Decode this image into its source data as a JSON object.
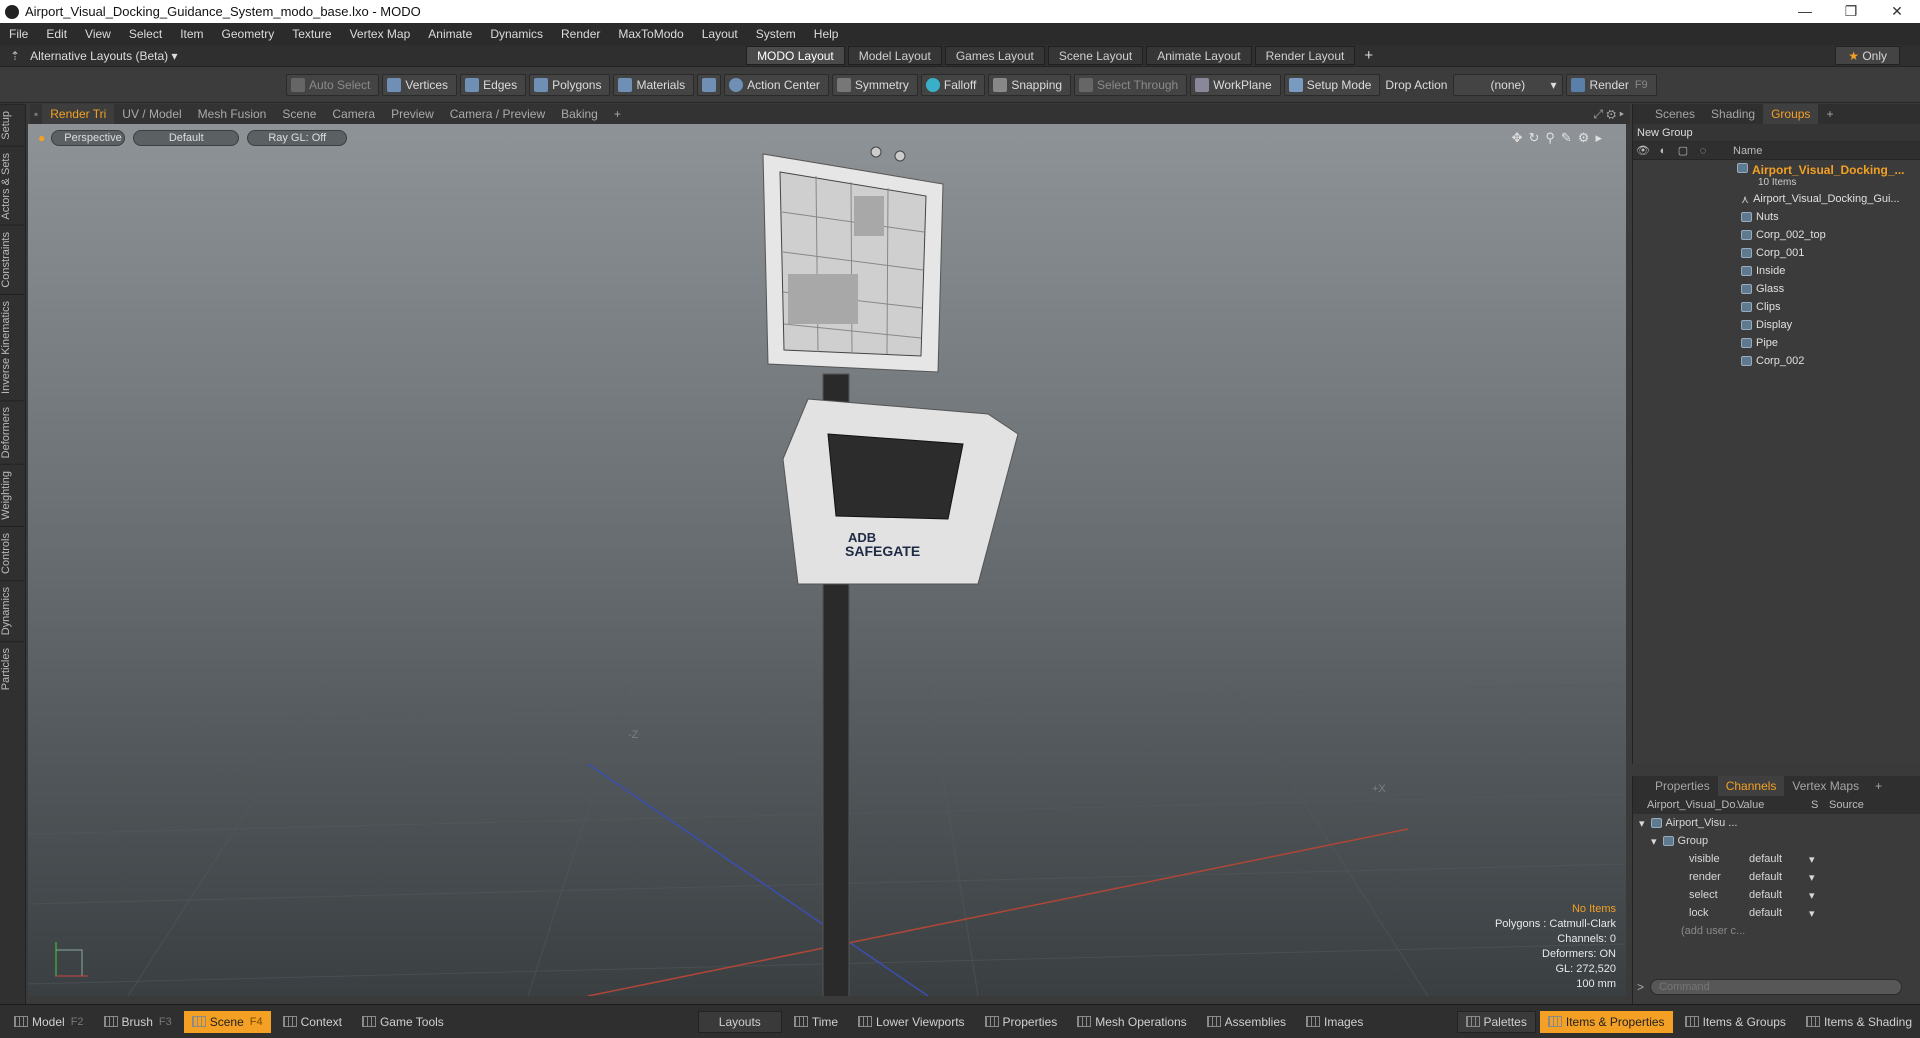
{
  "window": {
    "title": "Airport_Visual_Docking_Guidance_System_modo_base.lxo - MODO"
  },
  "menu": [
    "File",
    "Edit",
    "View",
    "Select",
    "Item",
    "Geometry",
    "Texture",
    "Vertex Map",
    "Animate",
    "Dynamics",
    "Render",
    "MaxToModo",
    "Layout",
    "System",
    "Help"
  ],
  "layouts": {
    "selector": "Alternative Layouts (Beta)",
    "tabs": [
      "MODO Layout",
      "Model Layout",
      "Games Layout",
      "Scene Layout",
      "Animate Layout",
      "Render Layout"
    ],
    "only": "Only"
  },
  "toolbar": {
    "auto_select": "Auto Select",
    "vertices": "Vertices",
    "edges": "Edges",
    "polygons": "Polygons",
    "materials": "Materials",
    "action_center": "Action Center",
    "symmetry": "Symmetry",
    "falloff": "Falloff",
    "snapping": "Snapping",
    "select_through": "Select Through",
    "workplane": "WorkPlane",
    "setup_mode": "Setup Mode",
    "drop_action": "Drop Action",
    "drop_value": "(none)",
    "render": "Render",
    "render_key": "F9"
  },
  "viewport_tabs": [
    "Render Tri",
    "UV / Model",
    "Mesh Fusion",
    "Scene",
    "Camera",
    "Preview",
    "Camera / Preview",
    "Baking"
  ],
  "left_strip": [
    "Setup",
    "Actors & Sets",
    "Constraints",
    "Inverse Kinematics",
    "Deformers",
    "Weighting",
    "Controls",
    "Dynamics",
    "Particles"
  ],
  "viewport": {
    "view": "Perspective",
    "shading": "Default",
    "raygl": "Ray GL: Off",
    "axis_z": "-Z",
    "axis_x": "+X",
    "info": {
      "selection": "No Items",
      "polygons": "Polygons : Catmull-Clark",
      "channels": "Channels: 0",
      "deformers": "Deformers: ON",
      "gl": "GL: 272,520",
      "scale": "100 mm"
    },
    "model_label_1": "ADB",
    "model_label_2": "SAFEGATE"
  },
  "groups_panel": {
    "tabs": [
      "Scenes",
      "Shading",
      "Groups"
    ],
    "new_group": "New Group",
    "name_col": "Name",
    "root": "Airport_Visual_Docking_...",
    "root_count": "10 Items",
    "items": [
      "Airport_Visual_Docking_Gui...",
      "Nuts",
      "Corp_002_top",
      "Corp_001",
      "Inside",
      "Glass",
      "Clips",
      "Display",
      "Pipe",
      "Corp_002"
    ]
  },
  "channels_panel": {
    "tabs": [
      "Properties",
      "Channels",
      "Vertex Maps"
    ],
    "col_item": "Airport_Visual_Do...",
    "col_value": "Value",
    "col_s": "S",
    "col_source": "Source",
    "root": "Airport_Visu ...",
    "group": "Group",
    "rows": [
      {
        "name": "visible",
        "value": "default"
      },
      {
        "name": "render",
        "value": "default"
      },
      {
        "name": "select",
        "value": "default"
      },
      {
        "name": "lock",
        "value": "default"
      }
    ],
    "add": "(add user c..."
  },
  "command": {
    "placeholder": "Command"
  },
  "statusbar": {
    "left": [
      {
        "label": "Model",
        "key": "F2"
      },
      {
        "label": "Brush",
        "key": "F3"
      },
      {
        "label": "Scene",
        "key": "F4"
      },
      {
        "label": "Context",
        "key": ""
      },
      {
        "label": "Game Tools",
        "key": ""
      }
    ],
    "center": [
      "Layouts",
      "Time",
      "Lower Viewports",
      "Properties",
      "Mesh Operations",
      "Assemblies",
      "Images"
    ],
    "right": [
      "Palettes",
      "Items & Properties",
      "Items & Groups",
      "Items & Shading"
    ]
  },
  "colors": {
    "accent": "#f4a024",
    "background": "#3a3a3a"
  }
}
